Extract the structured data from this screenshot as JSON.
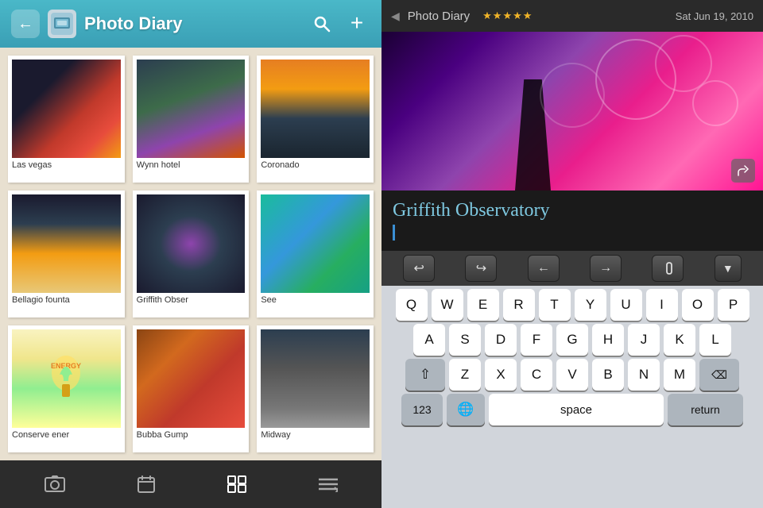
{
  "left": {
    "header": {
      "title": "Photo Diary",
      "back_label": "←",
      "search_label": "🔍",
      "add_label": "+"
    },
    "photos": [
      {
        "id": "lasvegas",
        "label": "Las vegas",
        "css": "photo-lasvegas"
      },
      {
        "id": "wynn",
        "label": "Wynn hotel",
        "css": "photo-wynn"
      },
      {
        "id": "coronado",
        "label": "Coronado",
        "css": "photo-coronado"
      },
      {
        "id": "bellagio",
        "label": "Bellagio founta",
        "css": "photo-bellagio"
      },
      {
        "id": "griffith",
        "label": "Griffith Obser",
        "css": "photo-griffith"
      },
      {
        "id": "see",
        "label": "See",
        "css": "photo-see"
      },
      {
        "id": "conserve",
        "label": "Conserve ener",
        "css": "photo-conserve"
      },
      {
        "id": "bubba",
        "label": "Bubba Gump",
        "css": "photo-bubba"
      },
      {
        "id": "midway",
        "label": "Midway",
        "css": "photo-midway"
      }
    ],
    "toolbar": {
      "photo_icon": "🖼",
      "calendar_icon": "📅",
      "grid_icon": "⊞",
      "menu_icon": "☰"
    }
  },
  "right": {
    "header": {
      "title": "Photo Diary",
      "stars": "★★★★★",
      "date": "Sat Jun 19, 2010",
      "chevron": "◀"
    },
    "entry": {
      "title": "Griffith Observatory"
    },
    "edit_toolbar": {
      "undo": "↩",
      "redo": "↪",
      "arrow_left": "←",
      "arrow_right": "→",
      "attach": "📎",
      "expand": "▼"
    },
    "keyboard": {
      "rows": [
        [
          "Q",
          "W",
          "E",
          "R",
          "T",
          "Y",
          "U",
          "I",
          "O",
          "P"
        ],
        [
          "A",
          "S",
          "D",
          "F",
          "G",
          "H",
          "J",
          "K",
          "L"
        ],
        [
          "Z",
          "X",
          "C",
          "V",
          "B",
          "N",
          "M"
        ]
      ],
      "shift": "⇧",
      "delete": "⌫",
      "num": "123",
      "globe": "🌐",
      "space": "space",
      "return": "return"
    }
  }
}
